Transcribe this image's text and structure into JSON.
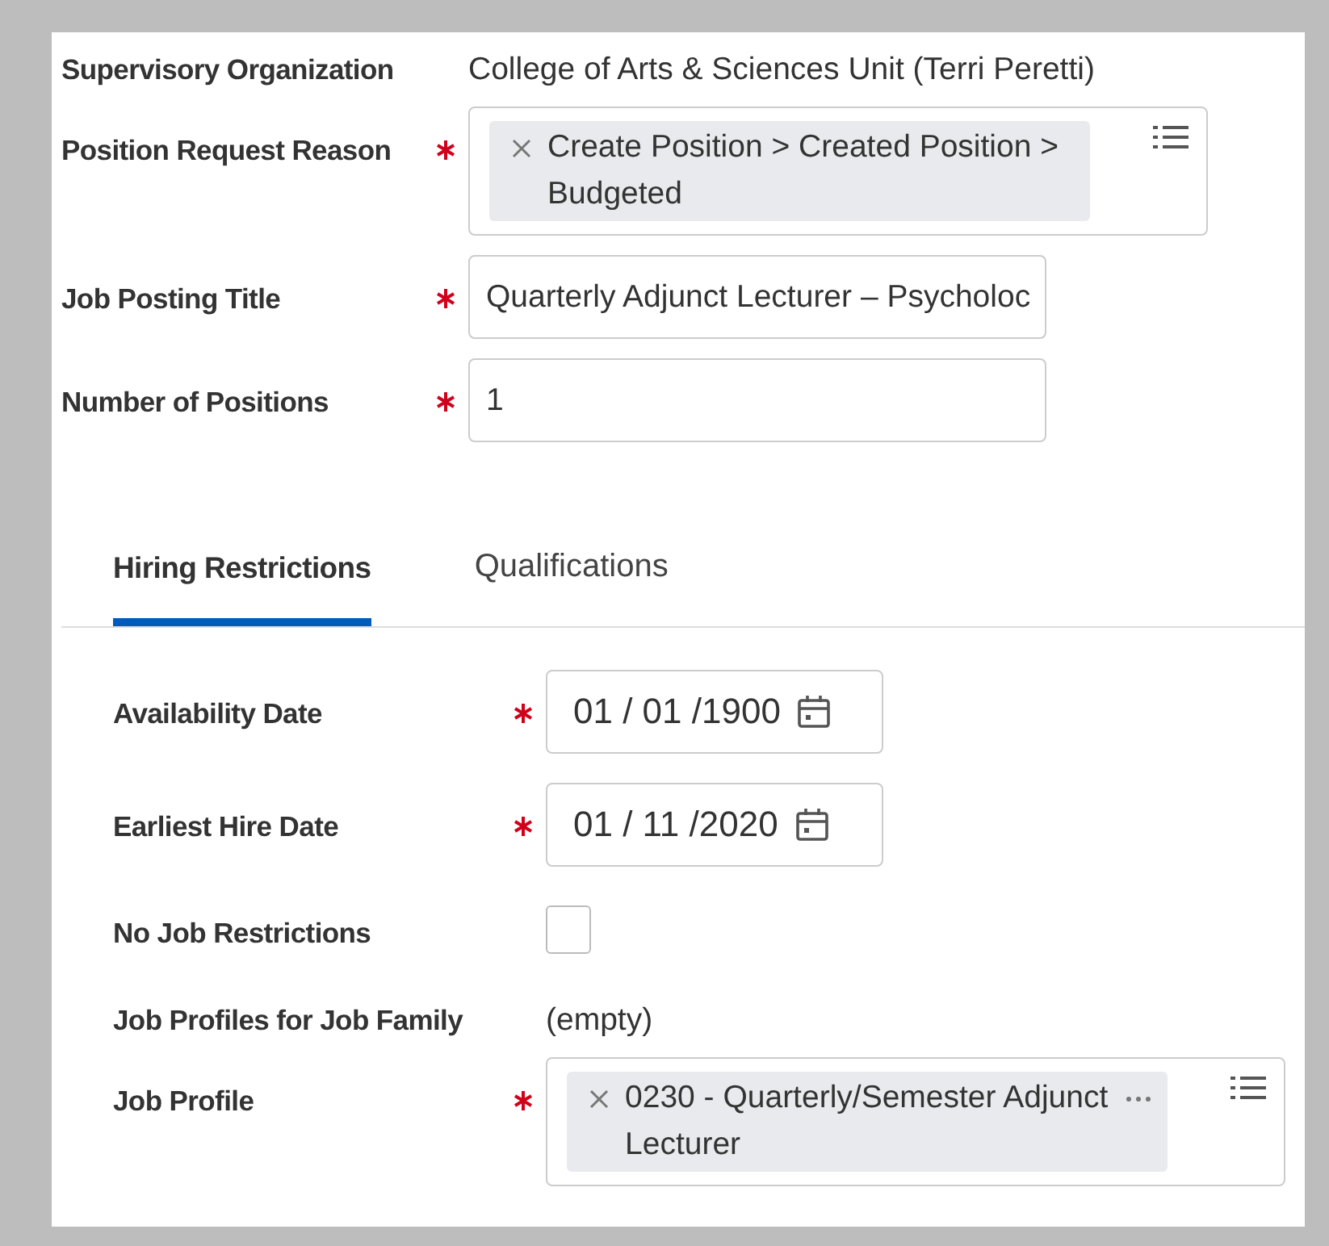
{
  "fields": [
    {
      "kind": "text",
      "label": "Supervisory Organization",
      "required": false,
      "value": "College of Arts & Sciences Unit (Terri Peretti)"
    },
    {
      "kind": "multiselect",
      "label": "Position Request Reason",
      "required": true,
      "chips": [
        {
          "text": "Create Position > Created Position > Budgeted",
          "more": false
        }
      ]
    },
    {
      "kind": "input",
      "label": "Job Posting Title",
      "required": true,
      "value": "Quarterly Adjunct Lecturer – Psycholoc"
    },
    {
      "kind": "input",
      "label": "Number of Positions",
      "required": true,
      "value": "1"
    }
  ],
  "tabs": [
    {
      "label": "Hiring Restrictions",
      "selected": true
    },
    {
      "label": "Qualifications",
      "selected": false
    }
  ],
  "tab_fields": [
    {
      "kind": "date",
      "label": "Availability Date",
      "required": true,
      "value": "01 / 01 /1900"
    },
    {
      "kind": "date",
      "label": "Earliest Hire Date",
      "required": true,
      "value": "01 / 11 /2020"
    },
    {
      "kind": "checkbox",
      "label": "No Job Restrictions",
      "required": false,
      "checked": false
    },
    {
      "kind": "text",
      "label": "Job Profiles for Job Family",
      "required": false,
      "value": "(empty)"
    },
    {
      "kind": "multiselect",
      "label": "Job Profile",
      "required": true,
      "chips": [
        {
          "text": "0230 - Quarterly/Semester Adjunct Lecturer",
          "more": true
        }
      ]
    }
  ]
}
